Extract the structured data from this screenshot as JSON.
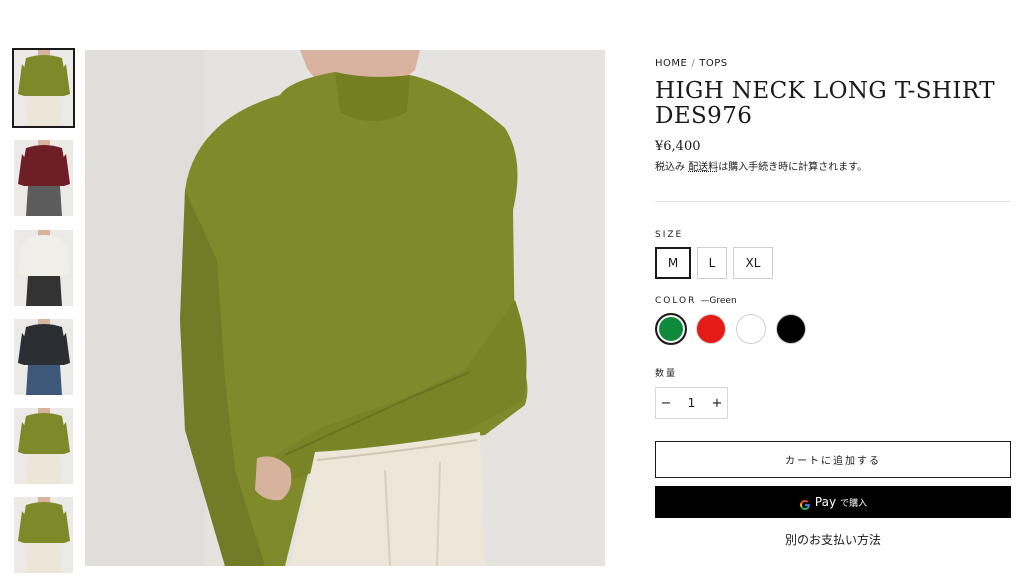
{
  "breadcrumb": {
    "home": "HOME",
    "category": "TOPS",
    "separator": "/"
  },
  "product": {
    "title": "HIGH NECK LONG T-SHIRT DES976",
    "price": "¥6,400",
    "tax_label": "税込み",
    "shipping_link": "配送料",
    "shipping_note": "は購入手続き時に計算されます。"
  },
  "size": {
    "label": "SIZE",
    "options": [
      {
        "label": "M",
        "selected": true
      },
      {
        "label": "L",
        "selected": false
      },
      {
        "label": "XL",
        "selected": false
      }
    ]
  },
  "color": {
    "label": "COLOR",
    "selected_text": "—Green",
    "options": [
      {
        "name": "Green",
        "hex": "#0f8a3a",
        "selected": true
      },
      {
        "name": "Red",
        "hex": "#e41b17",
        "selected": false
      },
      {
        "name": "White",
        "hex": "#ffffff",
        "selected": false
      },
      {
        "name": "Black",
        "hex": "#000000",
        "selected": false
      }
    ]
  },
  "quantity": {
    "label": "数量",
    "value": "1",
    "minus": "−",
    "plus": "+"
  },
  "actions": {
    "add_to_cart": "カートに追加する",
    "gpay_brand": "Pay",
    "gpay_suffix": "で購入",
    "more_payment": "別のお支払い方法"
  },
  "gallery": {
    "thumbnails": [
      {
        "name": "thumb-green-front",
        "shirt": "#7e8a2a",
        "pants": "#ece6d8",
        "active": true
      },
      {
        "name": "thumb-burgundy",
        "shirt": "#6e1f26",
        "pants": "#5c5c5c",
        "active": false
      },
      {
        "name": "thumb-white",
        "shirt": "#f1efe9",
        "pants": "#333333",
        "active": false
      },
      {
        "name": "thumb-black",
        "shirt": "#2b2e33",
        "pants": "#3d5878",
        "active": false
      },
      {
        "name": "thumb-green-side",
        "shirt": "#7e8a2a",
        "pants": "#ece6d8",
        "active": false
      },
      {
        "name": "thumb-green-back",
        "shirt": "#7e8a2a",
        "pants": "#ece6d8",
        "active": false
      }
    ],
    "main_colors": {
      "background": "#e4e3df",
      "shirt": "#7f8b2b",
      "shirt_shadow": "#667124",
      "pants": "#ede7da",
      "skin": "#d9b3a0"
    }
  }
}
